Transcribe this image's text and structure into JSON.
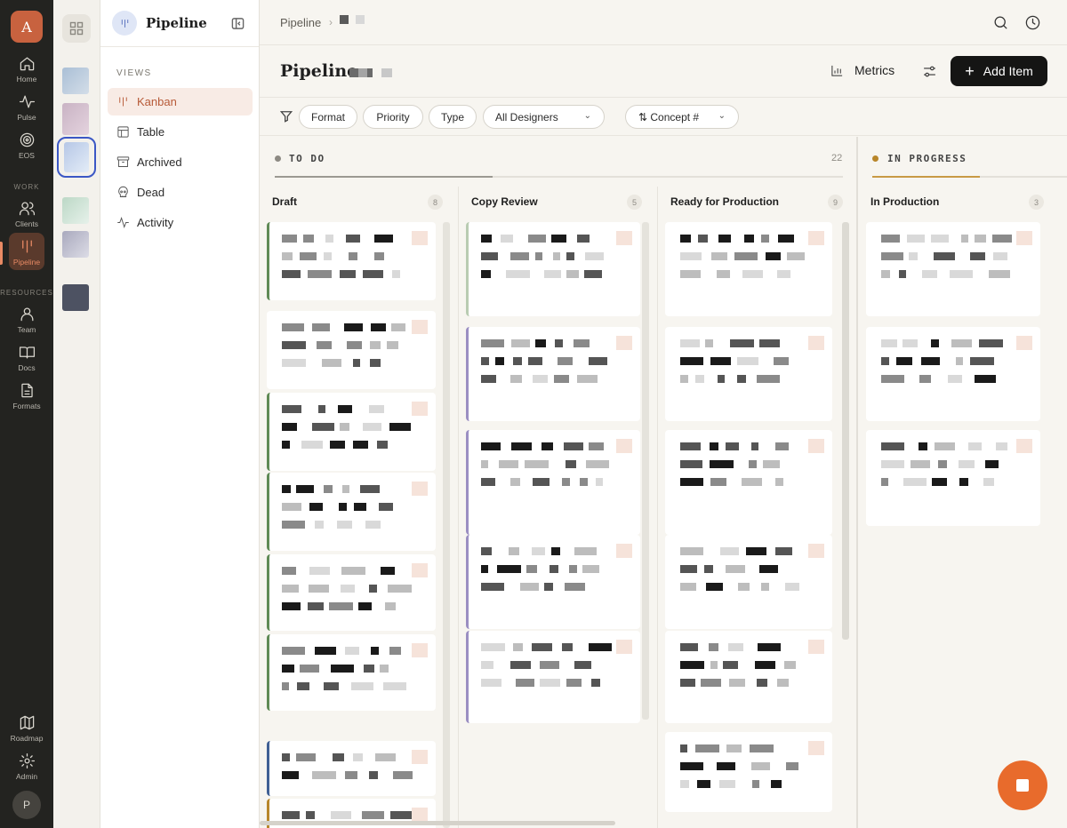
{
  "rail": {
    "logo_letter": "A",
    "items": [
      {
        "label": "Home",
        "icon": "home-icon"
      },
      {
        "label": "Pulse",
        "icon": "pulse-icon"
      },
      {
        "label": "EOS",
        "icon": "target-icon"
      },
      {
        "label": "Clients",
        "icon": "users-icon"
      },
      {
        "label": "Pipeline",
        "icon": "pipeline-icon"
      },
      {
        "label": "Team",
        "icon": "user-icon"
      },
      {
        "label": "Docs",
        "icon": "book-icon"
      },
      {
        "label": "Formats",
        "icon": "file-icon"
      },
      {
        "label": "Roadmap",
        "icon": "map-icon"
      },
      {
        "label": "Admin",
        "icon": "gear-icon"
      }
    ],
    "section_work": "WORK",
    "section_resources": "RESOURCES",
    "avatar_letter": "P"
  },
  "sidebar": {
    "title": "Pipeline",
    "views_label": "VIEWS",
    "views": [
      {
        "label": "Kanban",
        "icon": "kanban-icon"
      },
      {
        "label": "Table",
        "icon": "table-icon"
      },
      {
        "label": "Archived",
        "icon": "archive-icon"
      },
      {
        "label": "Dead",
        "icon": "skull-icon"
      },
      {
        "label": "Activity",
        "icon": "activity-icon"
      }
    ]
  },
  "topbar": {
    "breadcrumb": "Pipeline",
    "separator": "›"
  },
  "header": {
    "title": "Pipeline",
    "metrics_label": "Metrics",
    "add_label": "Add Item",
    "add_plus": "+"
  },
  "filters": {
    "format": "Format",
    "priority": "Priority",
    "type": "Type",
    "designers": "All Designers",
    "sort": "⇅ Concept #",
    "chevron": "⌄"
  },
  "colors": {
    "accent": "#b75a38",
    "todo_dot": "#8d8a83",
    "inprogress_dot": "#b8862a",
    "card_green": "#5f8a55",
    "card_blue": "#3f5f94",
    "card_gold": "#b8862a"
  },
  "board": {
    "groups": [
      {
        "name": "TO DO",
        "count": "22"
      },
      {
        "name": "IN PROGRESS",
        "count": ""
      }
    ],
    "columns": [
      {
        "name": "Draft",
        "count": "8"
      },
      {
        "name": "Copy Review",
        "count": "5"
      },
      {
        "name": "Ready for Production",
        "count": "9"
      },
      {
        "name": "In Production",
        "count": "3"
      }
    ]
  }
}
